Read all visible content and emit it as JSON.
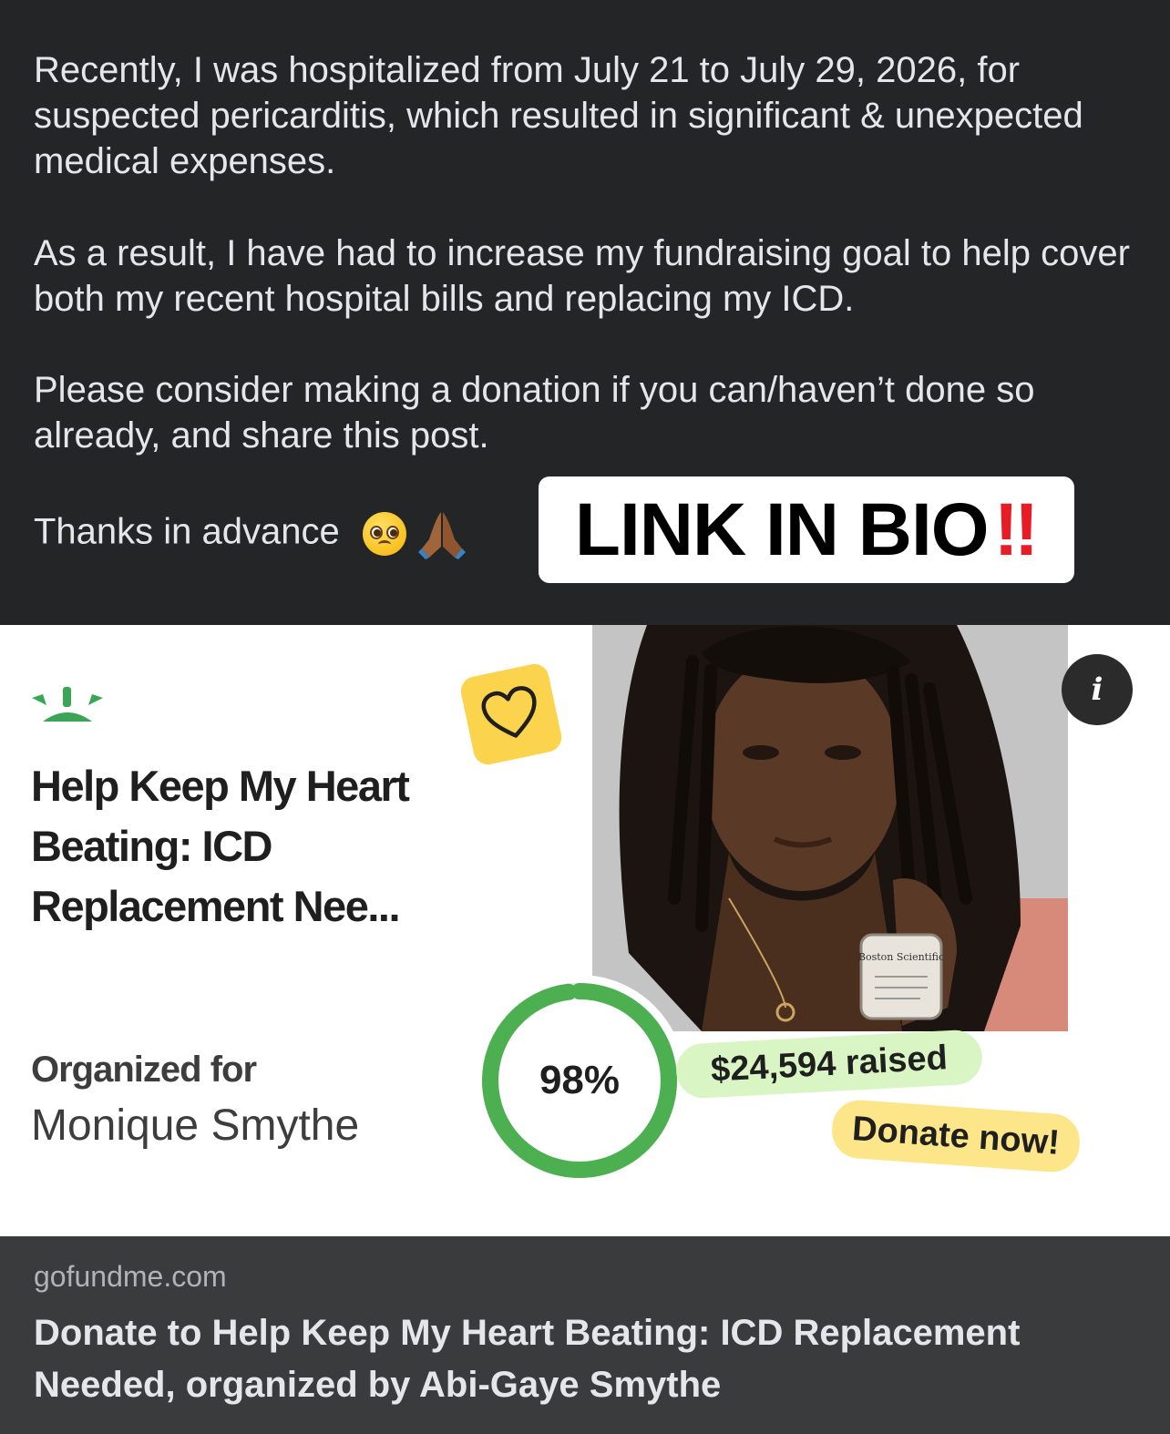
{
  "post": {
    "paragraph1": "Recently, I was hospitalized from July 21 to July 29, 2026, for suspected pericarditis, which resulted in significant & unexpected medical expenses.",
    "paragraph2": "As a result, I have had to increase my fundraising goal to help cover both my recent hospital bills and replacing my ICD.",
    "paragraph3": "Please consider making a donation if you can/haven’t done so already, and share this post.",
    "thanks": "Thanks in advance",
    "overlay_text": "LINK IN BIO",
    "overlay_mark": "‼"
  },
  "card": {
    "title": "Help Keep My Heart Beating: ICD Replacement Nee...",
    "organized_label": "Organized for",
    "organizer": "Monique Smythe",
    "progress_label": "98%",
    "progress_fraction": 0.98,
    "raised": "$24,594 raised",
    "donate": "Donate now!",
    "info_glyph": "i",
    "device_label": "Boston Scientific"
  },
  "link_preview": {
    "domain": "gofundme.com",
    "title": "Donate to Help Keep My Heart Beating: ICD Replacement Needed, organized by Abi-Gaye Smythe"
  },
  "colors": {
    "dark_bg": "#242526",
    "footer_bg": "#3a3b3c",
    "gfm_green": "#4caf50",
    "alert_red": "#e81c24",
    "heart_tile": "#fcd34d"
  }
}
